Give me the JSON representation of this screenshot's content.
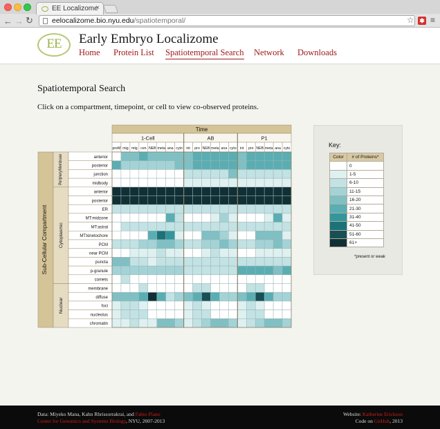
{
  "browser": {
    "tab_title": "EE Localizome",
    "url_host": "eelocalizome.bio.nyu.edu",
    "url_path": "/spatiotemporal/",
    "extension_badge": "✱"
  },
  "site": {
    "title": "Early Embryo Localizome",
    "logo_text": "EE",
    "brand_color": "#a01818",
    "nav": [
      {
        "label": "Home"
      },
      {
        "label": "Protein List"
      },
      {
        "label": "Spatiotemporal Search",
        "active": true
      },
      {
        "label": "Network"
      },
      {
        "label": "Downloads"
      }
    ]
  },
  "page": {
    "title": "Spatiotemporal Search",
    "instructions": "Click on a compartment, timepoint, or cell to view co-observed proteins."
  },
  "heatmap": {
    "time_label": "Time",
    "axis_label": "Sub-Cellular Compartment",
    "cells": [
      {
        "name": "1-Cell",
        "timepoints": [
          "preM",
          "mig",
          "mtg",
          "cen",
          "NEB",
          "meta",
          "ana",
          "cyto"
        ]
      },
      {
        "name": "AB",
        "timepoints": [
          "int",
          "pro",
          "NEB",
          "meta",
          "ana",
          "cyto"
        ]
      },
      {
        "name": "P1",
        "timepoints": [
          "int",
          "pro",
          "NEB",
          "meta",
          "ana",
          "cyto"
        ]
      }
    ],
    "groups": [
      {
        "name": "Periphery/Membrane",
        "rows": [
          "anterior",
          "posterior",
          "junction",
          "midbody"
        ]
      },
      {
        "name": "Cytoplasmic",
        "rows": [
          "anterior",
          "posterior",
          "ER",
          "MT:midzone",
          "MT:astral",
          "MT:kinetochore",
          "PCM",
          "near PCM",
          "puncta",
          "p-granule",
          "comets"
        ]
      },
      {
        "name": "Nuclear",
        "rows": [
          "membrane",
          "diffuse",
          "foci",
          "nucleolus",
          "chromatin"
        ]
      }
    ],
    "bins": [
      [
        0,
        4,
        4,
        5,
        4,
        4,
        4,
        4,
        4,
        5,
        5,
        5,
        5,
        5,
        4,
        5,
        5,
        5,
        5,
        5
      ],
      [
        5,
        3,
        3,
        3,
        3,
        3,
        3,
        4,
        4,
        5,
        5,
        5,
        5,
        5,
        4,
        5,
        5,
        5,
        5,
        5
      ],
      [
        0,
        0,
        0,
        0,
        0,
        0,
        0,
        0,
        2,
        2,
        2,
        2,
        2,
        4,
        2,
        2,
        2,
        2,
        2,
        2
      ],
      [
        0,
        0,
        0,
        0,
        0,
        0,
        0,
        0,
        1,
        1,
        1,
        1,
        1,
        1,
        1,
        1,
        1,
        1,
        1,
        1
      ],
      [
        9,
        9,
        9,
        9,
        9,
        9,
        9,
        9,
        9,
        9,
        9,
        9,
        9,
        9,
        9,
        9,
        9,
        9,
        9,
        9
      ],
      [
        9,
        9,
        9,
        9,
        9,
        9,
        9,
        9,
        9,
        9,
        9,
        9,
        9,
        9,
        9,
        9,
        9,
        9,
        9,
        9
      ],
      [
        2,
        2,
        2,
        2,
        2,
        2,
        2,
        2,
        2,
        2,
        2,
        2,
        2,
        2,
        2,
        2,
        2,
        2,
        2,
        2
      ],
      [
        0,
        0,
        0,
        0,
        0,
        0,
        5,
        2,
        0,
        0,
        0,
        1,
        3,
        1,
        0,
        0,
        0,
        1,
        5,
        1
      ],
      [
        0,
        2,
        2,
        2,
        2,
        2,
        2,
        2,
        2,
        2,
        2,
        2,
        2,
        2,
        2,
        2,
        2,
        2,
        2,
        2
      ],
      [
        0,
        0,
        0,
        0,
        5,
        7,
        6,
        1,
        0,
        0,
        4,
        4,
        3,
        1,
        0,
        0,
        4,
        4,
        4,
        1
      ],
      [
        2,
        2,
        2,
        3,
        3,
        4,
        4,
        3,
        2,
        2,
        3,
        3,
        4,
        3,
        2,
        2,
        3,
        3,
        4,
        3
      ],
      [
        0,
        0,
        1,
        1,
        1,
        2,
        1,
        1,
        0,
        0,
        1,
        2,
        1,
        1,
        0,
        0,
        1,
        1,
        1,
        1
      ],
      [
        4,
        4,
        2,
        2,
        1,
        2,
        2,
        2,
        2,
        2,
        2,
        2,
        2,
        2,
        2,
        2,
        2,
        2,
        2,
        2
      ],
      [
        3,
        3,
        3,
        3,
        3,
        3,
        3,
        3,
        2,
        2,
        2,
        2,
        2,
        2,
        5,
        5,
        5,
        5,
        4,
        5
      ],
      [
        0,
        2,
        0,
        0,
        0,
        0,
        0,
        0,
        0,
        0,
        0,
        0,
        0,
        0,
        0,
        0,
        0,
        0,
        0,
        0
      ],
      [
        0,
        0,
        0,
        2,
        0,
        0,
        0,
        0,
        0,
        2,
        2,
        0,
        0,
        0,
        0,
        2,
        2,
        0,
        0,
        0
      ],
      [
        4,
        4,
        4,
        5,
        9,
        5,
        2,
        3,
        4,
        5,
        8,
        5,
        3,
        3,
        4,
        5,
        8,
        5,
        3,
        3
      ],
      [
        1,
        2,
        2,
        1,
        0,
        0,
        0,
        0,
        1,
        2,
        1,
        0,
        0,
        0,
        1,
        2,
        1,
        0,
        0,
        0
      ],
      [
        1,
        2,
        2,
        2,
        0,
        0,
        0,
        0,
        1,
        2,
        2,
        0,
        0,
        0,
        1,
        2,
        2,
        0,
        0,
        0
      ],
      [
        1,
        1,
        2,
        1,
        1,
        4,
        4,
        3,
        1,
        2,
        3,
        4,
        4,
        3,
        1,
        2,
        3,
        4,
        4,
        3
      ]
    ]
  },
  "key": {
    "title": "Key:",
    "col_color": "Color",
    "col_count": "# of Proteins*",
    "entries": [
      {
        "label": "0",
        "color": "#ffffff"
      },
      {
        "label": "1-5",
        "color": "#dff0f1"
      },
      {
        "label": "6-10",
        "color": "#c2e2e4"
      },
      {
        "label": "11-15",
        "color": "#a3d3d6"
      },
      {
        "label": "16-20",
        "color": "#7fc0c4"
      },
      {
        "label": "21-30",
        "color": "#5aaeb3"
      },
      {
        "label": "31-40",
        "color": "#33969c"
      },
      {
        "label": "41-50",
        "color": "#1d7278"
      },
      {
        "label": "51-60",
        "color": "#184f55"
      },
      {
        "label": "61+",
        "color": "#103035"
      }
    ],
    "note": "*present or weak"
  },
  "colors": {
    "header_tan": "#d5c497",
    "group_tan": "#e6dcc2"
  },
  "footer": {
    "left_line1_prefix": "Data: Miyeko Mana, Kahn Rhrissorrakrai, and ",
    "left_link1": "Fabio Piano",
    "left_link2": "Center for Genomics and Systems Biology",
    "left_line2_suffix": ", NYU, 2007-2013",
    "right_prefix": "Website: ",
    "right_link1": "Katherine Erickson",
    "right_code_prefix": "Code on ",
    "right_link2": "GitHub",
    "right_code_suffix": ", 2013"
  }
}
